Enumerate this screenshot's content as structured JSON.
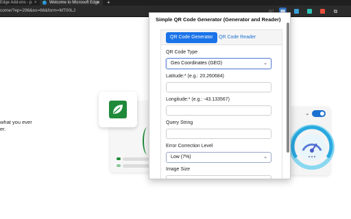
{
  "browser": {
    "tabs": [
      {
        "label": "Edge Add-ons - p"
      },
      {
        "label": "Welcome to Microsoft Edge"
      }
    ],
    "close_glyph": "×",
    "new_tab_glyph": "+",
    "url": "come/?ep=296&es=66&form=MT00LJ",
    "toolbar_icons": [
      "star-icon",
      "qr-extension-icon",
      "extension-icon",
      "extension-icon",
      "extension-icon",
      "extension-icon"
    ]
  },
  "background_page": {
    "text_lines": [
      "what you ever",
      "er."
    ]
  },
  "popup": {
    "title": "Simple QR Code Generator (Generator and Reader)",
    "tabs": {
      "generator": "QR Code Generator",
      "reader": "QR Code Reader"
    },
    "qr_type_label": "QR Code Type",
    "qr_type_value": "Geo Coordinates (GEO)",
    "latitude_label": "Latitude:* (e.g.: 20.260684)",
    "longitude_label": "Longitude:* (e.g.: -43.133567)",
    "query_label": "Query String",
    "ecl_label": "Error Correction Level",
    "ecl_value": "Low (7%)",
    "image_size_label": "Image Size",
    "caret": "⌄"
  },
  "colors": {
    "accent": "#1a73e8",
    "toolbar_bg": "#2b2b2b",
    "leaf_green": "#1f8a3a"
  }
}
